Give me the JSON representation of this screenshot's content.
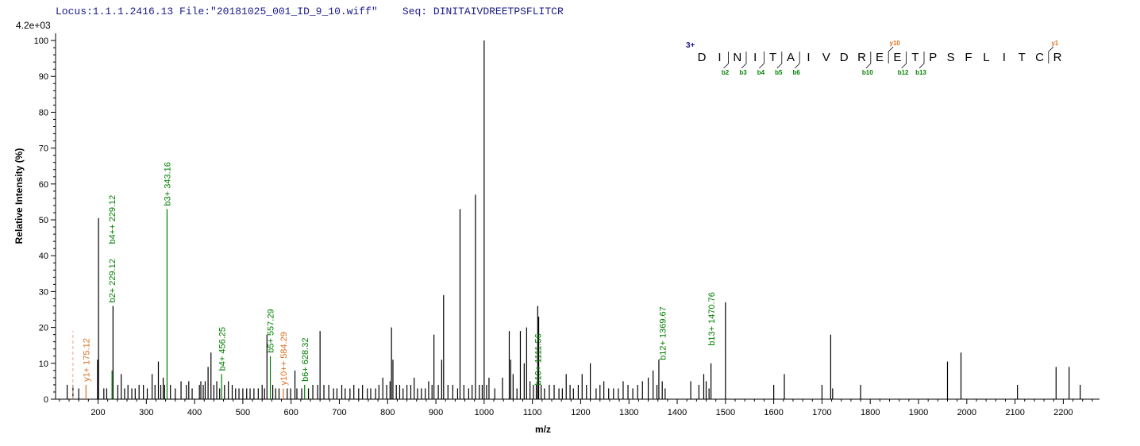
{
  "header": {
    "locus": "Locus:1.1.1.2416.13",
    "file": "File:\"20181025_001_ID_9_10.wiff\"",
    "seq": "Seq: DINITAIVDREETPSFLITCR"
  },
  "colors": {
    "b_ion": "#008000",
    "y_ion": "#e07020",
    "peak": "#000000",
    "charge": "#1a1a8c"
  },
  "chart_data": {
    "type": "bar",
    "title": "",
    "max_intensity_label": "4.2e+03",
    "xlabel": "m/z",
    "ylabel": "Relative   Intensity (%)",
    "xlim": [
      112,
      2275
    ],
    "ylim": [
      0,
      102
    ],
    "x_ticks": [
      200,
      300,
      400,
      500,
      600,
      700,
      800,
      900,
      1000,
      1100,
      1200,
      1300,
      1400,
      1500,
      1600,
      1700,
      1800,
      1900,
      2000,
      2100,
      2200
    ],
    "y_ticks": [
      0,
      10,
      20,
      30,
      40,
      50,
      60,
      70,
      80,
      90,
      100
    ],
    "peaks": [
      [
        136,
        4
      ],
      [
        148,
        4
      ],
      [
        160,
        3
      ],
      [
        175,
        4
      ],
      [
        199,
        11
      ],
      [
        201,
        50.5
      ],
      [
        212,
        3
      ],
      [
        218,
        3
      ],
      [
        229,
        8
      ],
      [
        231,
        26
      ],
      [
        241,
        4
      ],
      [
        248,
        7
      ],
      [
        255,
        3
      ],
      [
        262,
        4
      ],
      [
        270,
        3
      ],
      [
        277,
        3
      ],
      [
        285,
        4
      ],
      [
        294,
        4
      ],
      [
        302,
        3
      ],
      [
        312,
        7
      ],
      [
        318,
        4
      ],
      [
        325,
        10.5
      ],
      [
        330,
        4
      ],
      [
        335,
        6
      ],
      [
        338,
        4
      ],
      [
        343,
        53
      ],
      [
        350,
        4
      ],
      [
        360,
        3
      ],
      [
        372,
        5
      ],
      [
        383,
        4
      ],
      [
        388,
        5
      ],
      [
        395,
        3
      ],
      [
        410,
        4
      ],
      [
        413,
        5
      ],
      [
        418,
        4
      ],
      [
        422,
        5
      ],
      [
        428,
        9
      ],
      [
        434,
        13
      ],
      [
        440,
        4
      ],
      [
        446,
        5
      ],
      [
        452,
        3
      ],
      [
        456,
        7
      ],
      [
        462,
        4
      ],
      [
        470,
        5
      ],
      [
        478,
        4
      ],
      [
        485,
        3
      ],
      [
        492,
        3
      ],
      [
        500,
        3
      ],
      [
        508,
        3
      ],
      [
        515,
        3
      ],
      [
        523,
        3
      ],
      [
        532,
        3
      ],
      [
        540,
        4
      ],
      [
        545,
        3
      ],
      [
        550,
        18
      ],
      [
        557,
        12
      ],
      [
        562,
        4
      ],
      [
        568,
        3
      ],
      [
        575,
        3
      ],
      [
        584,
        3
      ],
      [
        592,
        3
      ],
      [
        599,
        3
      ],
      [
        608,
        8
      ],
      [
        612,
        3
      ],
      [
        622,
        3
      ],
      [
        628,
        4
      ],
      [
        636,
        3
      ],
      [
        645,
        4
      ],
      [
        655,
        4
      ],
      [
        660,
        19
      ],
      [
        668,
        4
      ],
      [
        678,
        4
      ],
      [
        688,
        3
      ],
      [
        695,
        3
      ],
      [
        705,
        4
      ],
      [
        712,
        3
      ],
      [
        722,
        3
      ],
      [
        730,
        4
      ],
      [
        740,
        3
      ],
      [
        748,
        4
      ],
      [
        758,
        3
      ],
      [
        765,
        3
      ],
      [
        775,
        3
      ],
      [
        782,
        4
      ],
      [
        790,
        6
      ],
      [
        798,
        4
      ],
      [
        805,
        5
      ],
      [
        808,
        20
      ],
      [
        811,
        11
      ],
      [
        818,
        4
      ],
      [
        825,
        4
      ],
      [
        832,
        3
      ],
      [
        840,
        4
      ],
      [
        848,
        4
      ],
      [
        855,
        6
      ],
      [
        862,
        3
      ],
      [
        870,
        3
      ],
      [
        878,
        3
      ],
      [
        885,
        5
      ],
      [
        892,
        4
      ],
      [
        896,
        18
      ],
      [
        905,
        4
      ],
      [
        912,
        11
      ],
      [
        916,
        29
      ],
      [
        925,
        4
      ],
      [
        935,
        4
      ],
      [
        945,
        3
      ],
      [
        950,
        53
      ],
      [
        958,
        4
      ],
      [
        968,
        3
      ],
      [
        975,
        4
      ],
      [
        982,
        57
      ],
      [
        990,
        4
      ],
      [
        996,
        4
      ],
      [
        1000,
        100
      ],
      [
        1005,
        4
      ],
      [
        1010,
        6
      ],
      [
        1022,
        3
      ],
      [
        1038,
        6
      ],
      [
        1052,
        19
      ],
      [
        1055,
        11
      ],
      [
        1060,
        7
      ],
      [
        1068,
        3
      ],
      [
        1075,
        19
      ],
      [
        1083,
        10
      ],
      [
        1088,
        20
      ],
      [
        1095,
        5
      ],
      [
        1102,
        4
      ],
      [
        1108,
        4
      ],
      [
        1111,
        26
      ],
      [
        1113,
        23
      ],
      [
        1118,
        4
      ],
      [
        1125,
        3
      ],
      [
        1135,
        4
      ],
      [
        1145,
        4
      ],
      [
        1155,
        3
      ],
      [
        1162,
        3
      ],
      [
        1170,
        7
      ],
      [
        1178,
        4
      ],
      [
        1185,
        3
      ],
      [
        1195,
        4
      ],
      [
        1203,
        7
      ],
      [
        1212,
        4
      ],
      [
        1220,
        10
      ],
      [
        1232,
        3
      ],
      [
        1240,
        4
      ],
      [
        1248,
        5
      ],
      [
        1258,
        3
      ],
      [
        1268,
        3
      ],
      [
        1278,
        3
      ],
      [
        1288,
        5
      ],
      [
        1298,
        4
      ],
      [
        1308,
        3
      ],
      [
        1318,
        4
      ],
      [
        1328,
        5
      ],
      [
        1340,
        6
      ],
      [
        1350,
        8
      ],
      [
        1358,
        4
      ],
      [
        1362,
        11
      ],
      [
        1369,
        5
      ],
      [
        1375,
        3
      ],
      [
        1428,
        5
      ],
      [
        1445,
        4
      ],
      [
        1455,
        7
      ],
      [
        1460,
        5
      ],
      [
        1466,
        3
      ],
      [
        1470,
        10
      ],
      [
        1500,
        27
      ],
      [
        1600,
        4
      ],
      [
        1622,
        7
      ],
      [
        1700,
        4
      ],
      [
        1718,
        18
      ],
      [
        1722,
        3
      ],
      [
        1780,
        4
      ],
      [
        1960,
        10.5
      ],
      [
        1988,
        13
      ],
      [
        2105,
        4
      ],
      [
        2185,
        9
      ],
      [
        2212,
        9
      ],
      [
        2235,
        4
      ]
    ],
    "annotations": [
      {
        "mz": 175.12,
        "label": "y1+ 175.12",
        "ion": "y",
        "intensity": 4
      },
      {
        "mz": 229.12,
        "label": "b2+ 229.12",
        "ion": "b",
        "intensity": 26
      },
      {
        "mz": 229.12,
        "label": "b4++ 229.12",
        "ion": "b",
        "intensity": 26,
        "stack": true
      },
      {
        "mz": 343.16,
        "label": "b3+ 343.16",
        "ion": "b",
        "intensity": 53
      },
      {
        "mz": 456.25,
        "label": "b4+ 456.25",
        "ion": "b",
        "intensity": 7
      },
      {
        "mz": 557.29,
        "label": "b5+ 557.29",
        "ion": "b",
        "intensity": 12
      },
      {
        "mz": 584.29,
        "label": "y10++ 584.29",
        "ion": "y",
        "intensity": 3
      },
      {
        "mz": 628.32,
        "label": "b6+ 628.32",
        "ion": "b",
        "intensity": 4
      },
      {
        "mz": 1111.56,
        "label": "b10+ 1111.56",
        "ion": "b",
        "intensity": 3
      },
      {
        "mz": 1369.67,
        "label": "b12+ 1369.67",
        "ion": "b",
        "intensity": 10
      },
      {
        "mz": 1470.76,
        "label": "b13+ 1470.76",
        "ion": "b",
        "intensity": 14
      }
    ],
    "sequence": {
      "charge": "3+",
      "letters": [
        "D",
        "I",
        "N",
        "I",
        "T",
        "A",
        "I",
        "V",
        "D",
        "R",
        "E",
        "E",
        "T",
        "P",
        "S",
        "F",
        "L",
        "I",
        "T",
        "C",
        "R"
      ],
      "b_fragments": [
        {
          "n": 2,
          "label": "b2"
        },
        {
          "n": 3,
          "label": "b3"
        },
        {
          "n": 4,
          "label": "b4"
        },
        {
          "n": 5,
          "label": "b5"
        },
        {
          "n": 6,
          "label": "b6"
        },
        {
          "n": 10,
          "label": "b10"
        },
        {
          "n": 12,
          "label": "b12"
        },
        {
          "n": 13,
          "label": "b13"
        }
      ],
      "y_fragments": [
        {
          "n": 10,
          "label": "y10"
        },
        {
          "n": 1,
          "label": "y1"
        }
      ]
    }
  }
}
